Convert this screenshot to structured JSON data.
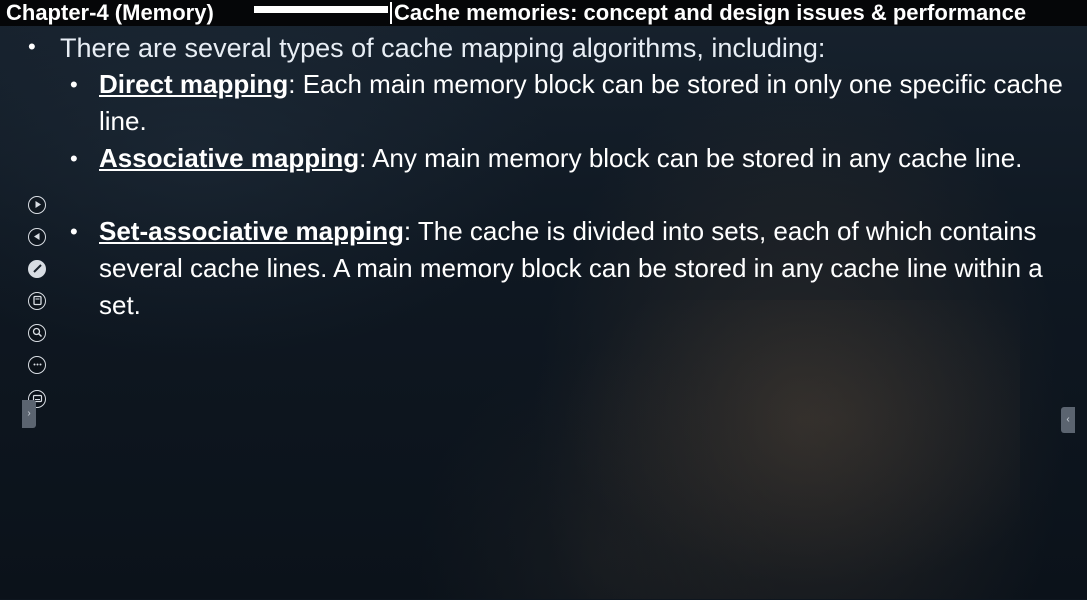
{
  "header": {
    "chapter": "Chapter-4 (Memory)",
    "section": "Cache memories: concept and design issues & performance"
  },
  "slide": {
    "intro": "There are several types of cache mapping algorithms, including:",
    "items": [
      {
        "term": "Direct mapping",
        "description": ": Each main memory block can be stored in only one specific cache line."
      },
      {
        "term": "Associative mapping",
        "description": ": Any main memory block can be stored in any cache line."
      },
      {
        "term": "Set-associative mapping",
        "description": ": The cache is divided into sets, each of which contains several cache lines. A main memory block can be stored in any cache line within a set."
      }
    ]
  },
  "toolbar": {
    "icons": [
      "next-slide-icon",
      "previous-slide-icon",
      "pen-icon",
      "highlighter-icon",
      "zoom-icon",
      "more-options-icon",
      "subtitle-icon"
    ]
  },
  "colors": {
    "header_background": "#050608",
    "slide_background": "#0f1822",
    "text": "#ffffff"
  }
}
